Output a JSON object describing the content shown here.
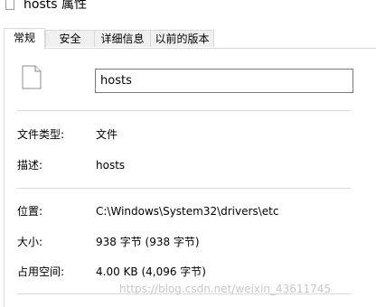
{
  "window": {
    "title": "hosts 属性"
  },
  "tabs": [
    {
      "label": "常规",
      "active": true
    },
    {
      "label": "安全",
      "active": false
    },
    {
      "label": "详细信息",
      "active": false
    },
    {
      "label": "以前的版本",
      "active": false
    }
  ],
  "general": {
    "file_name": "hosts",
    "file_icon": "document-icon",
    "type_label": "文件类型:",
    "type_value": "文件",
    "description_label": "描述:",
    "description_value": "hosts",
    "location_label": "位置:",
    "location_value": "C:\\Windows\\System32\\drivers\\etc",
    "size_label": "大小:",
    "size_value": "938 字节 (938 字节)",
    "size_on_disk_label": "占用空间:",
    "size_on_disk_value": "4.00 KB (4,096 字节)"
  },
  "watermark": "https://blog.csdn.net/weixin_43611745",
  "colors": {
    "tab_border": "#d9d9d9",
    "tab_inactive_bg": "#f0f0f0",
    "field_border": "#7a7a7a",
    "divider": "#d9d9d9"
  }
}
